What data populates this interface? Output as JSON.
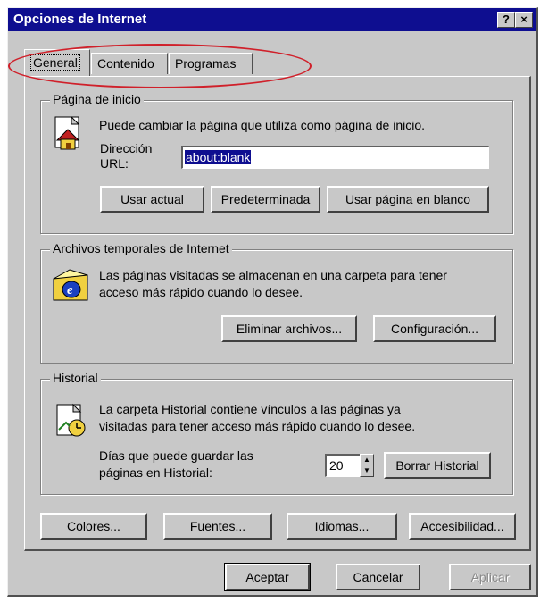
{
  "window": {
    "title": "Opciones de Internet",
    "help_button": "?",
    "close_button": "×"
  },
  "tabs": [
    {
      "label": "General",
      "active": true
    },
    {
      "label": "Contenido",
      "active": false
    },
    {
      "label": "Programas",
      "active": false
    }
  ],
  "home_page": {
    "group_title": "Página de inicio",
    "description": "Puede cambiar la página que utiliza como página de inicio.",
    "url_label_1": "Dirección",
    "url_label_2": "URL:",
    "url_value": "about:blank",
    "buttons": {
      "use_current": "Usar actual",
      "use_default": "Predeterminada",
      "use_blank": "Usar página en blanco"
    }
  },
  "temp_files": {
    "group_title": "Archivos temporales de Internet",
    "description_1": "Las páginas visitadas se almacenan en una carpeta para tener",
    "description_2": "acceso más rápido cuando lo desee.",
    "buttons": {
      "delete_files": "Eliminar archivos...",
      "settings": "Configuración..."
    }
  },
  "history": {
    "group_title": "Historial",
    "description_1": "La carpeta Historial contiene vínculos a las páginas ya",
    "description_2": "visitadas para tener acceso más rápido cuando lo desee.",
    "days_label_1": "Días que puede guardar las",
    "days_label_2": "páginas en Historial:",
    "days_value": "20",
    "clear_button": "Borrar Historial"
  },
  "bottom_buttons": {
    "colors": "Colores...",
    "fonts": "Fuentes...",
    "languages": "Idiomas...",
    "accessibility": "Accesibilidad..."
  },
  "dialog_buttons": {
    "ok": "Aceptar",
    "cancel": "Cancelar",
    "apply": "Aplicar"
  },
  "colors": {
    "title_bar": "#0e0e90",
    "dialog_face": "#c8c8c8",
    "annotation": "#d0202a"
  }
}
